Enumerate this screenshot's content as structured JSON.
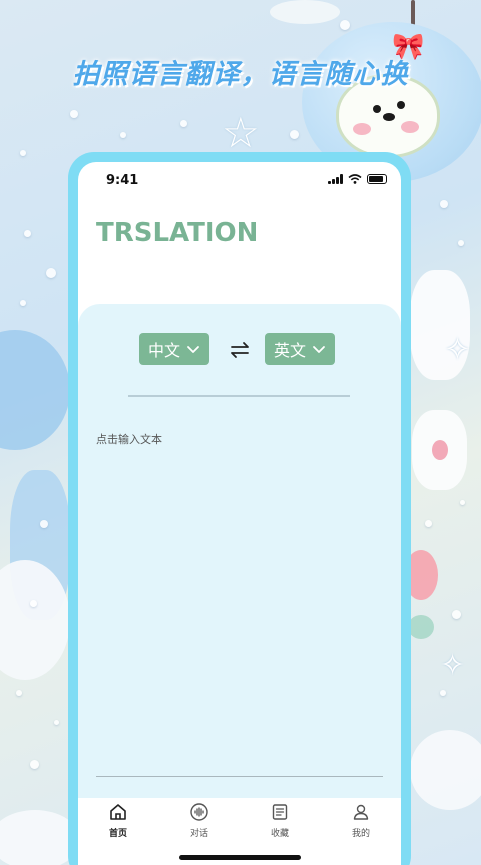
{
  "banner": {
    "headline": "拍照语言翻译，语言随心换"
  },
  "status_bar": {
    "time": "9:41"
  },
  "app": {
    "title": "TRSLATION"
  },
  "translator": {
    "source_language": "中文",
    "target_language": "英文",
    "input_placeholder": "点击输入文本"
  },
  "tabbar": {
    "items": [
      {
        "label": "首页",
        "icon": "home-icon",
        "active": true
      },
      {
        "label": "对话",
        "icon": "voice-chat-icon",
        "active": false
      },
      {
        "label": "收藏",
        "icon": "favorites-list-icon",
        "active": false
      },
      {
        "label": "我的",
        "icon": "profile-icon",
        "active": false
      }
    ]
  },
  "colors": {
    "accent_green": "#7cb795",
    "title_green": "#79b394",
    "panel_bg": "#e2f5fb",
    "phone_frame": "#7fdcf4",
    "headline_blue": "#4fa8ea"
  }
}
